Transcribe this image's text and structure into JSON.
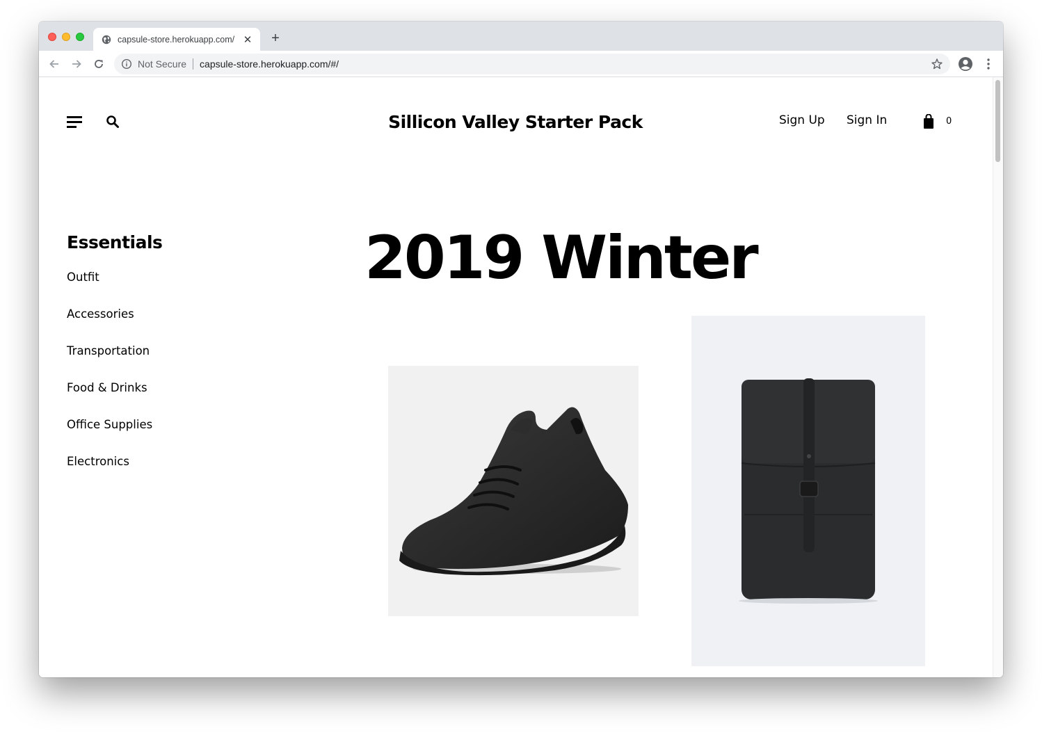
{
  "browser": {
    "tab_title": "capsule-store.herokuapp.com/",
    "security_label": "Not Secure",
    "url": "capsule-store.herokuapp.com/#/"
  },
  "header": {
    "brand": "Sillicon Valley Starter Pack",
    "sign_up": "Sign Up",
    "sign_in": "Sign In",
    "cart_count": "0"
  },
  "sidebar": {
    "title": "Essentials",
    "items": [
      {
        "label": "Outfit"
      },
      {
        "label": "Accessories"
      },
      {
        "label": "Transportation"
      },
      {
        "label": "Food & Drinks"
      },
      {
        "label": "Office Supplies"
      },
      {
        "label": "Electronics"
      }
    ]
  },
  "main": {
    "title": "2019 Winter",
    "products": [
      {
        "icon": "sneaker-image"
      },
      {
        "icon": "backpack-image"
      }
    ]
  }
}
